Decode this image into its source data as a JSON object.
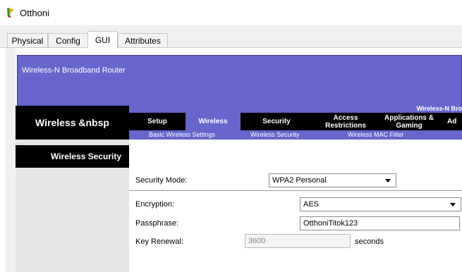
{
  "window": {
    "title": "Otthoni",
    "icon": "pt-device-icon"
  },
  "tabs": [
    {
      "label": "Physical",
      "active": false
    },
    {
      "label": "Config",
      "active": false
    },
    {
      "label": "GUI",
      "active": true
    },
    {
      "label": "Attributes",
      "active": false
    }
  ],
  "router": {
    "banner_title": "Wireless-N Broadband Router",
    "model_label": "Wireless-N Bro",
    "section_title": "Wireless &nbsp",
    "nav_tabs": [
      {
        "label": "Setup",
        "active": false
      },
      {
        "label": "Wireless",
        "active": true
      },
      {
        "label": "Security",
        "active": false
      },
      {
        "label": "Access Restrictions",
        "active": false
      },
      {
        "label": "Applications & Gaming",
        "active": false
      },
      {
        "label": "Ad",
        "active": false
      }
    ],
    "sub_links": [
      "Basic Wireless Settings",
      "Wireless Security",
      "Wireless MAC Filter"
    ],
    "sidebar_heading": "Wireless Security"
  },
  "form": {
    "security_mode": {
      "label": "Security Mode:",
      "value": "WPA2 Personal"
    },
    "encryption": {
      "label": "Encryption:",
      "value": "AES"
    },
    "passphrase": {
      "label": "Passphrase:",
      "value": "OtthoniTitok123"
    },
    "key_renewal": {
      "label": "Key Renewal:",
      "value": "3600",
      "unit": "seconds"
    }
  },
  "colors": {
    "accent": "#6666cc",
    "black": "#000000"
  }
}
